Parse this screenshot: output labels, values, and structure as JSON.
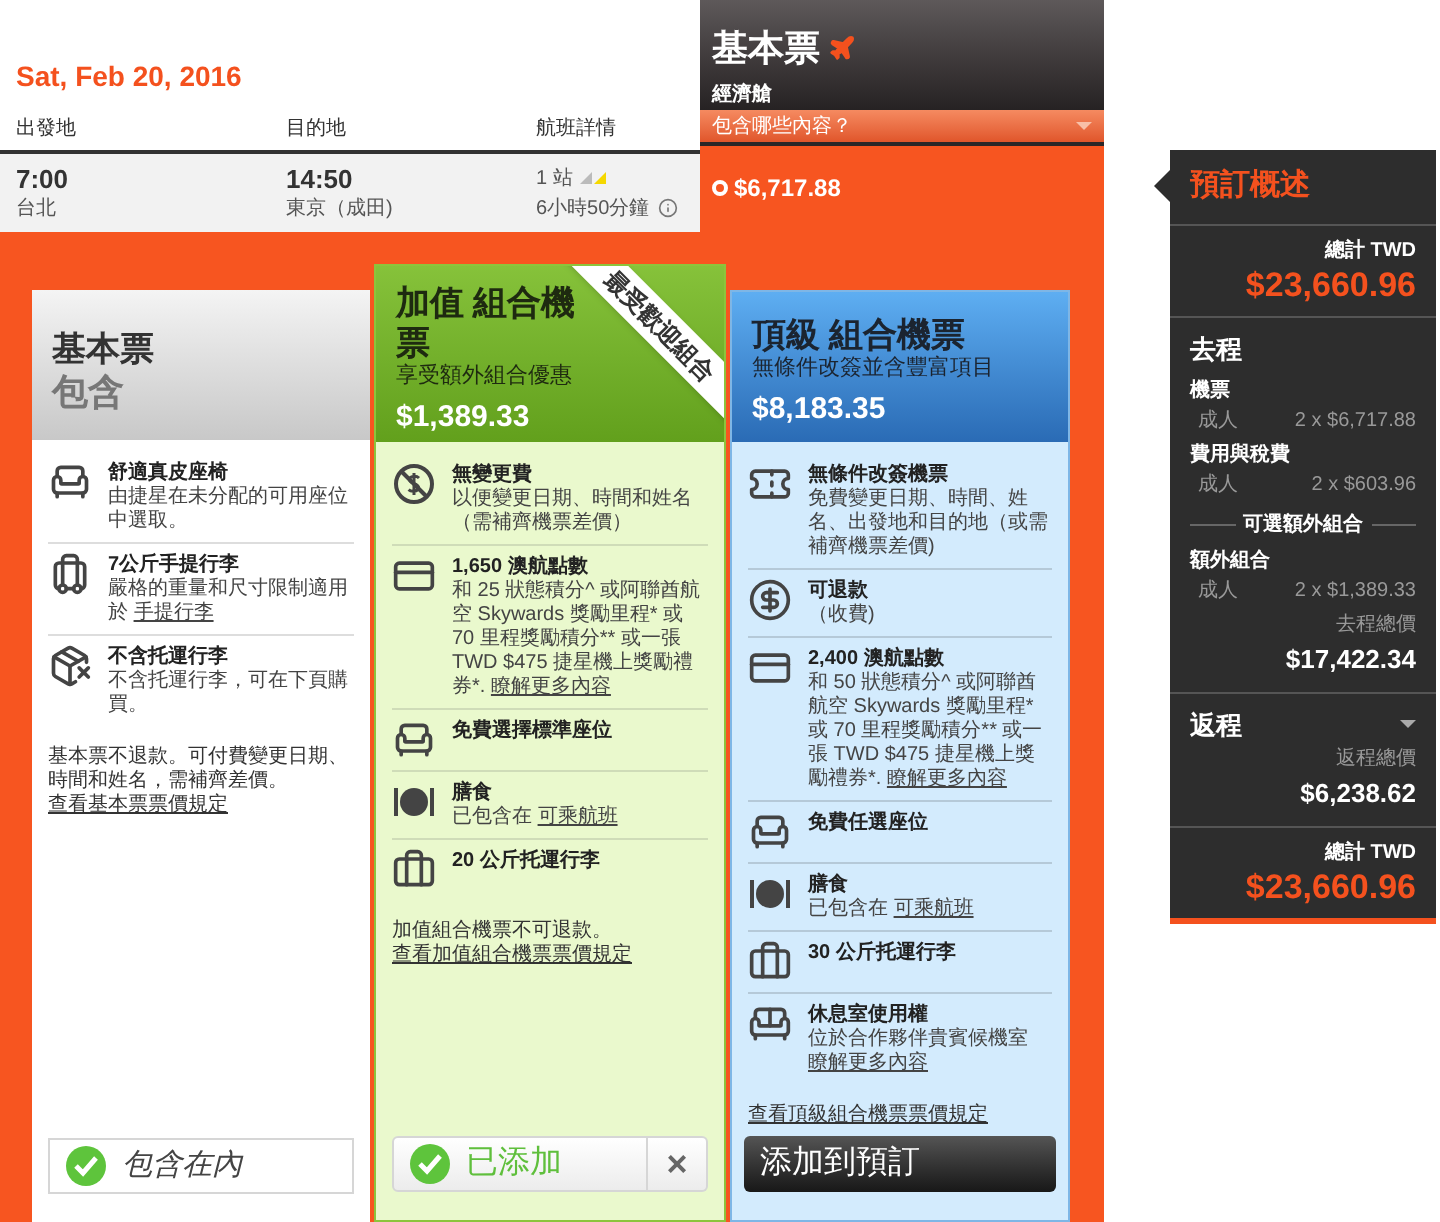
{
  "date": "Sat, Feb 20, 2016",
  "flight_table": {
    "columns": [
      "出發地",
      "目的地",
      "航班詳情"
    ],
    "row": {
      "depart_time": "7:00",
      "depart_city": "台北",
      "arrive_time": "14:50",
      "arrive_city": "東京（成田)",
      "stops": "1 站",
      "duration": "6小時50分鐘"
    }
  },
  "fare": {
    "title": "基本票",
    "cabin": "經濟艙",
    "dropdown": "包含哪些內容？",
    "price": "$6,717.88",
    "selected": true
  },
  "bundles": [
    {
      "kind": "basic",
      "title": "基本票",
      "subtitle": "包含",
      "features": [
        {
          "kind": "seat",
          "title": "舒適真皮座椅",
          "text": "由捷星在未分配的可用座位中選取。"
        },
        {
          "kind": "carryon",
          "title": "7公斤手提行李",
          "text": "嚴格的重量和尺寸限制適用於",
          "link": "手提行李"
        },
        {
          "kind": "nobag",
          "title": "不含托運行李",
          "text": "不含托運行李，可在下頁購買。"
        }
      ],
      "note": "基本票不退款。可付費變更日期、時間和姓名，需補齊差價。",
      "note_link": "查看基本票票價規定",
      "button": {
        "kind": "included",
        "label": "包含在內"
      }
    },
    {
      "kind": "plus",
      "title": "加值 組合機票",
      "subtitle": "享受額外組合優惠",
      "price": "$1,389.33",
      "ribbon": "最受歡迎組合",
      "features": [
        {
          "kind": "nofee",
          "title": "無變更費",
          "text": "以便變更日期、時間和姓名（需補齊機票差價）"
        },
        {
          "kind": "points",
          "title": "1,650 澳航點數",
          "text": "和 25 狀態積分^ 或阿聯酋航空 Skywards 獎勵里程* 或 70 里程獎勵積分** 或一張 TWD $475 捷星機上獎勵禮券*.",
          "link": "瞭解更多內容"
        },
        {
          "kind": "seat",
          "title": "免費選擇標準座位"
        },
        {
          "kind": "meal",
          "title": "膳食",
          "text": "已包含在",
          "link": "可乘航班"
        },
        {
          "kind": "bag",
          "title": "20 公斤托運行李"
        }
      ],
      "note": "加值組合機票不可退款。",
      "note_link": "查看加值組合機票票價規定",
      "button": {
        "kind": "added",
        "label": "已添加",
        "remove": "×"
      }
    },
    {
      "kind": "max",
      "title": "頂級 組合機票",
      "subtitle": "無條件改簽並含豐富項目",
      "price": "$8,183.35",
      "features": [
        {
          "kind": "ticket",
          "title": "無條件改簽機票",
          "text": "免費變更日期、時間、姓名、出發地和目的地（或需補齊機票差價)"
        },
        {
          "kind": "refund",
          "title": "可退款",
          "text": "（收費)"
        },
        {
          "kind": "points",
          "title": "2,400 澳航點數",
          "text": "和 50 狀態積分^ 或阿聯酋航空 Skywards 獎勵里程* 或 70 里程獎勵積分** 或一張 TWD $475 捷星機上獎勵禮券*.",
          "link": "瞭解更多內容"
        },
        {
          "kind": "seat",
          "title": "免費任選座位"
        },
        {
          "kind": "meal",
          "title": "膳食",
          "text": "已包含在",
          "link": "可乘航班"
        },
        {
          "kind": "bag",
          "title": "30 公斤托運行李"
        },
        {
          "kind": "lounge",
          "title": "休息室使用權",
          "text": "位於合作夥伴貴賓候機室",
          "link": "瞭解更多內容"
        }
      ],
      "note_link": "查看頂級組合機票票價規定",
      "button": {
        "kind": "add",
        "label": "添加到預訂"
      }
    }
  ],
  "summary": {
    "title": "預訂概述",
    "total_label": "總計 TWD",
    "total": "$23,660.96",
    "outbound": {
      "title": "去程",
      "items": [
        {
          "kind": "line",
          "title": "機票",
          "label": "成人",
          "value": "2 x $6,717.88"
        },
        {
          "kind": "line",
          "title": "費用與稅費",
          "label": "成人",
          "value": "2 x $603.96"
        },
        {
          "kind": "divider",
          "title": "可選額外組合"
        },
        {
          "kind": "line",
          "title": "額外組合",
          "label": "成人",
          "value": "2 x $1,389.33"
        }
      ],
      "subtotal_label": "去程總價",
      "subtotal": "$17,422.34"
    },
    "return": {
      "title": "返程",
      "subtotal_label": "返程總價",
      "subtotal": "$6,238.62"
    },
    "footer_total_label": "總計 TWD",
    "footer_total": "$23,660.96"
  }
}
